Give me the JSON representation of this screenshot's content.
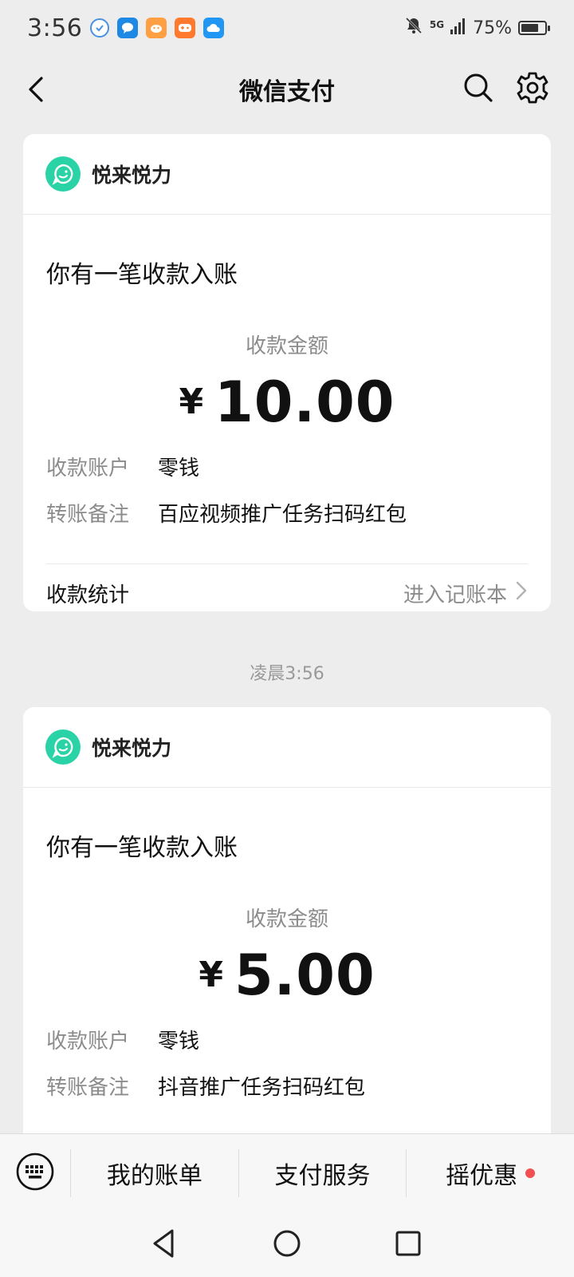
{
  "status_bar": {
    "time": "3:56",
    "network": "5G",
    "battery_percent": "75%",
    "battery_level": 0.75
  },
  "navbar": {
    "title": "微信支付"
  },
  "cards": [
    {
      "sender": "悦来悦力",
      "heading": "你有一笔收款入账",
      "amount_label": "收款金额",
      "currency_symbol": "¥",
      "amount": "10.00",
      "account_label": "收款账户",
      "account_value": "零钱",
      "remark_label": "转账备注",
      "remark_value": "百应视频推广任务扫码红包",
      "stats_label": "收款统计",
      "ledger_link": "进入记账本"
    },
    {
      "sender": "悦来悦力",
      "heading": "你有一笔收款入账",
      "amount_label": "收款金额",
      "currency_symbol": "¥",
      "amount": "5.00",
      "account_label": "收款账户",
      "account_value": "零钱",
      "remark_label": "转账备注",
      "remark_value": "抖音推广任务扫码红包"
    }
  ],
  "time_divider": "凌晨3:56",
  "bottom_bar": {
    "tabs": [
      "我的账单",
      "支付服务",
      "摇优惠"
    ]
  },
  "colors": {
    "accent_green": "#2ad3a6",
    "badge_red": "#f25050"
  }
}
